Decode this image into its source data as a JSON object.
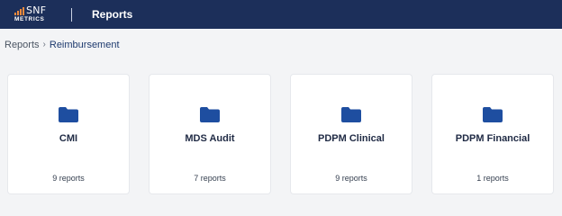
{
  "app": {
    "logo_text": "SNF",
    "logo_subtext": "METRICS",
    "page_title": "Reports"
  },
  "breadcrumb": {
    "root": "Reports",
    "current": "Reimbursement"
  },
  "cards": [
    {
      "title": "CMI",
      "count": "9 reports"
    },
    {
      "title": "MDS Audit",
      "count": "7 reports"
    },
    {
      "title": "PDPM Clinical",
      "count": "9 reports"
    },
    {
      "title": "PDPM Financial",
      "count": "1 reports"
    }
  ],
  "colors": {
    "topbar": "#1c2f5a",
    "folder": "#1e4ea0",
    "logo_accent": "#f08a3c",
    "background": "#f3f4f6"
  },
  "icons": {
    "logo": "snf-metrics-logo",
    "breadcrumb_separator": "chevron-right-icon",
    "card": "folder-icon"
  }
}
